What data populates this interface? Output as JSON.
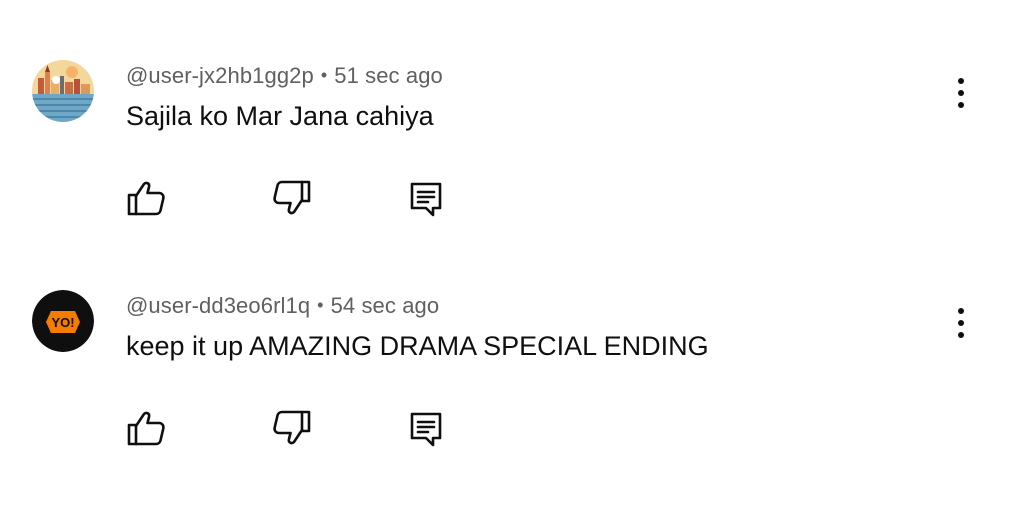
{
  "comments": [
    {
      "username": "@user-jx2hb1gg2p",
      "separator": "•",
      "time": "51 sec ago",
      "text": "Sajila ko Mar Jana cahiya",
      "avatar_style": "city-illustration"
    },
    {
      "username": "@user-dd3eo6rl1q",
      "separator": "•",
      "time": "54 sec ago",
      "text": "keep it up AMAZING DRAMA SPECIAL ENDING",
      "avatar_label": "YO!"
    }
  ],
  "icons": {
    "like": "thumbs-up-icon",
    "dislike": "thumbs-down-icon",
    "reply": "reply-comment-icon",
    "more": "more-vertical-icon"
  },
  "colors": {
    "text": "#0f0f0f",
    "meta": "#606060",
    "avatar2_bg": "#0f0f0f",
    "avatar2_badge": "#f57c00"
  }
}
